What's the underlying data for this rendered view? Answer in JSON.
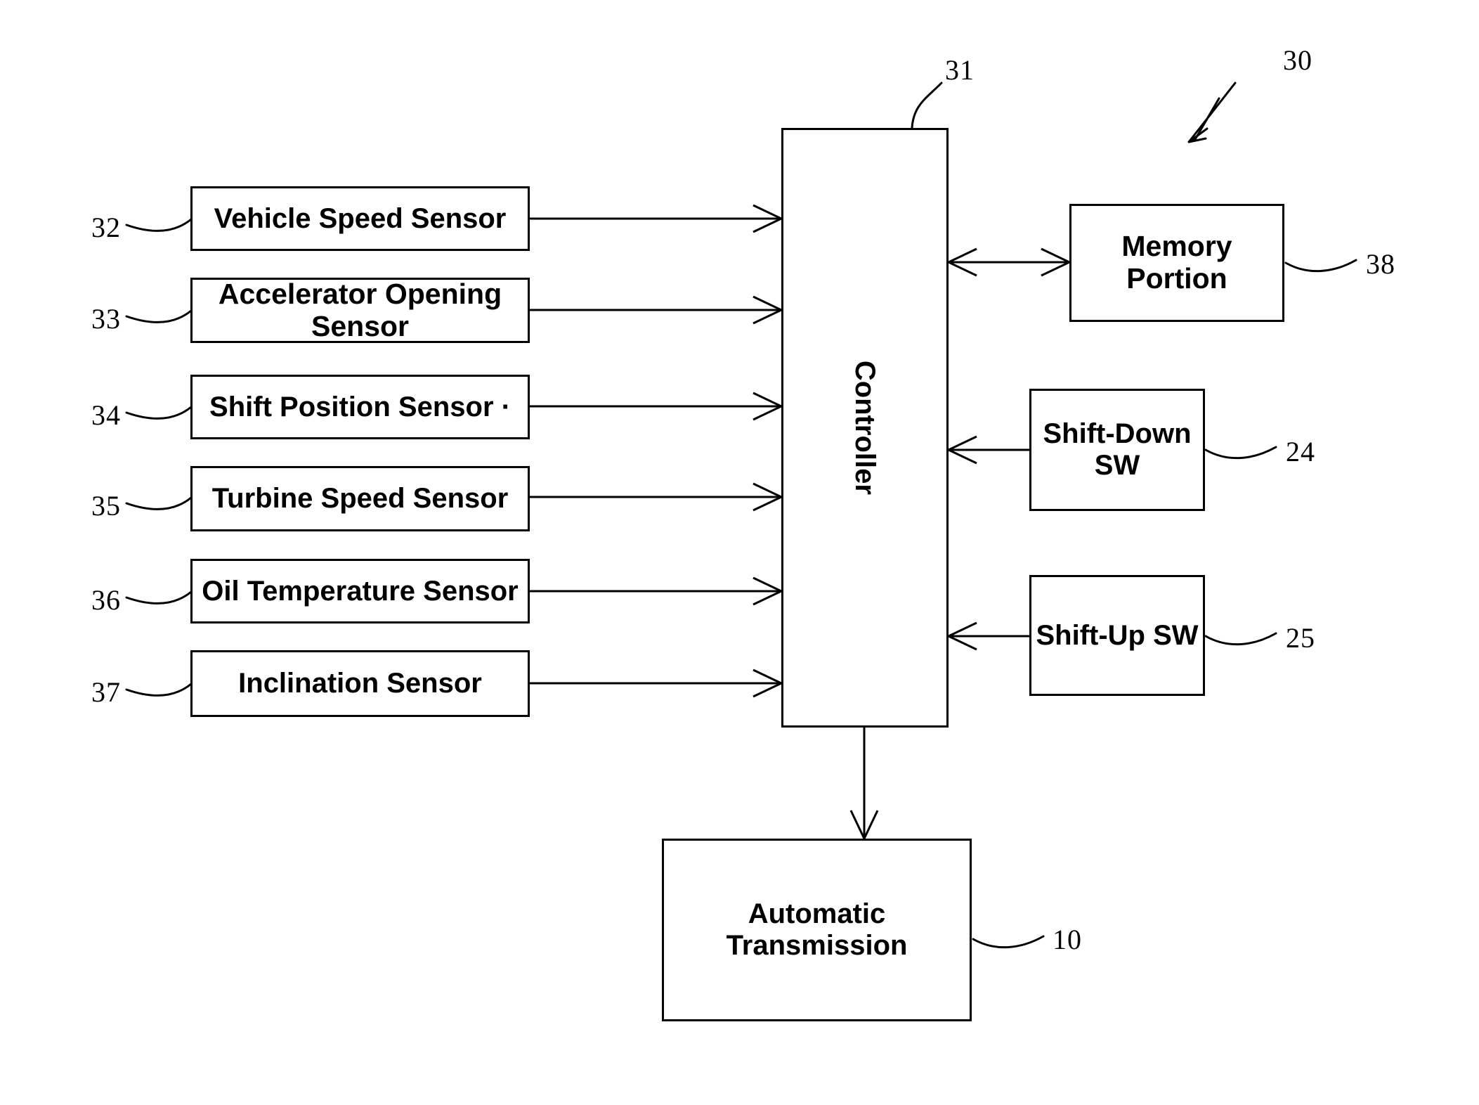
{
  "figure": {
    "type": "patent-block-diagram",
    "system_reference": "30",
    "boxes": {
      "sensors": [
        {
          "label": "Vehicle Speed Sensor",
          "ref": "32"
        },
        {
          "label": "Accelerator Opening Sensor",
          "ref": "33"
        },
        {
          "label": "Shift Position Sensor ·",
          "ref": "34"
        },
        {
          "label": "Turbine Speed Sensor",
          "ref": "35"
        },
        {
          "label": "Oil Temperature Sensor",
          "ref": "36"
        },
        {
          "label": "Inclination Sensor",
          "ref": "37"
        }
      ],
      "controller": {
        "label": "Controller",
        "ref": "31"
      },
      "right": [
        {
          "label": "Memory Portion",
          "ref": "38"
        },
        {
          "label": "Shift-Down SW",
          "ref": "24"
        },
        {
          "label": "Shift-Up SW",
          "ref": "25"
        }
      ],
      "output": {
        "label_line1": "Automatic",
        "label_line2": "Transmission",
        "ref": "10"
      }
    },
    "colors": {
      "line": "#000000",
      "background": "#ffffff",
      "text": "#000000"
    }
  }
}
